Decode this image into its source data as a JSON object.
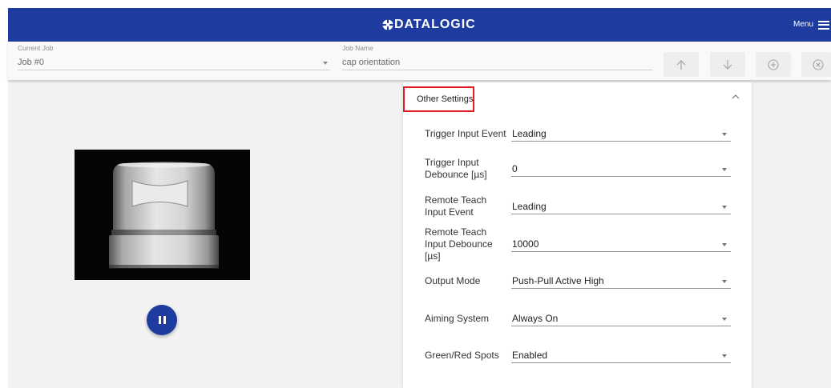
{
  "theme": {
    "brand_color": "#1e3c9f",
    "highlight_color": "#e31b23"
  },
  "header": {
    "logo_text": "DATALOGIC",
    "logo_icon": "datalogic-logo-icon",
    "menu_label": "Menu",
    "menu_icon": "hamburger-menu-icon"
  },
  "job_bar": {
    "current_job": {
      "label": "Current Job",
      "value": "Job #0"
    },
    "job_name": {
      "label": "Job Name",
      "value": "cap orientation"
    },
    "actions": [
      {
        "icon": "arrow-up-icon"
      },
      {
        "icon": "arrow-down-icon"
      },
      {
        "icon": "add-circle-icon"
      },
      {
        "icon": "close-circle-icon"
      }
    ]
  },
  "preview": {
    "control_icon": "pause-icon"
  },
  "settings_panel": {
    "title": "Other Settings",
    "toggle_icon": "chevron-up-icon",
    "rows": [
      {
        "label": "Trigger Input Event",
        "value": "Leading"
      },
      {
        "label": "Trigger Input Debounce [µs]",
        "value": "0"
      },
      {
        "label": "Remote Teach Input Event",
        "value": "Leading"
      },
      {
        "label": "Remote Teach Input Debounce [µs]",
        "value": "10000"
      },
      {
        "label": "Output Mode",
        "value": "Push-Pull Active High"
      },
      {
        "label": "Aiming System",
        "value": "Always On"
      },
      {
        "label": "Green/Red Spots",
        "value": "Enabled"
      }
    ]
  }
}
